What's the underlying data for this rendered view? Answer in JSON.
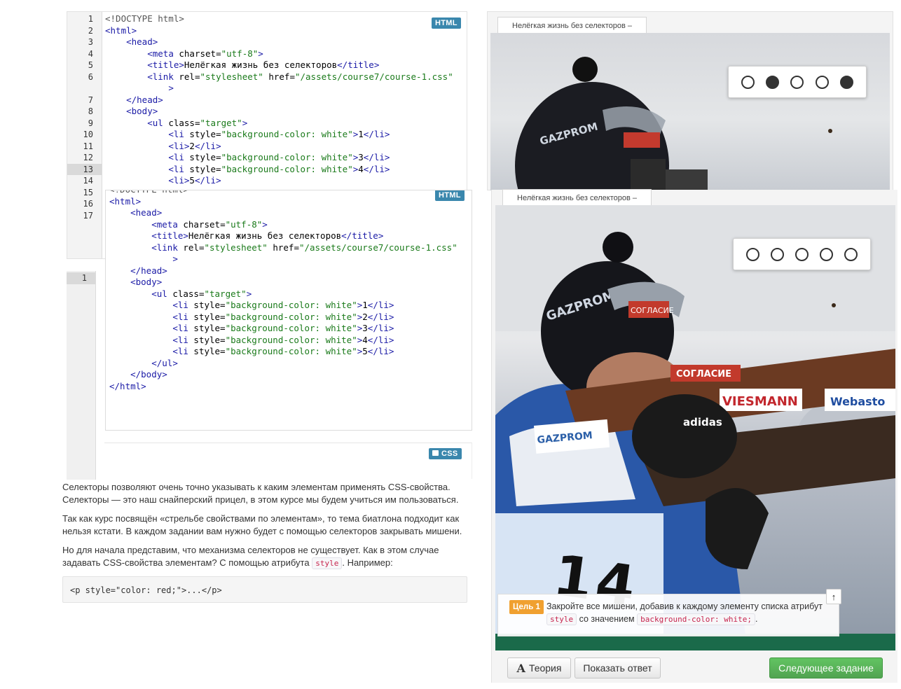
{
  "html_editor_back": {
    "badge": "HTML",
    "line_numbers": [
      "1",
      "2",
      "3",
      "4",
      "5",
      "6",
      "",
      "7",
      "8",
      "9",
      "10",
      "11",
      "12",
      "13",
      "14",
      "15",
      "16",
      "17"
    ],
    "lines": [
      "<!DOCTYPE html>",
      "<html>",
      "    <head>",
      "        <meta charset=\"utf-8\">",
      "        <title>Нелёгкая жизнь без селекторов</title>",
      "        <link rel=\"stylesheet\" href=\"/assets/course7/course-1.css\"",
      "            >",
      "    </head>",
      "    <body>",
      "        <ul class=\"target\">",
      "            <li style=\"background-color: white\">1</li>",
      "            <li>2</li>",
      "            <li style=\"background-color: white\">3</li>",
      "            <li style=\"background-color: white\">4</li>",
      "            <li>5</li>"
    ]
  },
  "html_editor_front": {
    "badge": "HTML",
    "lines": [
      "<!DOCTYPE html>",
      "<html>",
      "    <head>",
      "        <meta charset=\"utf-8\">",
      "        <title>Нелёгкая жизнь без селекторов</title>",
      "        <link rel=\"stylesheet\" href=\"/assets/course7/course-1.css\"",
      "            >",
      "    </head>",
      "    <body>",
      "        <ul class=\"target\">",
      "            <li style=\"background-color: white\">1</li>",
      "            <li style=\"background-color: white\">2</li>",
      "            <li style=\"background-color: white\">3</li>",
      "            <li style=\"background-color: white\">4</li>",
      "            <li style=\"background-color: white\">5</li>",
      "        </ul>",
      "    </body>",
      "</html>"
    ]
  },
  "css_editor": {
    "line_number": "1",
    "badge": "CSS"
  },
  "preview_back": {
    "tab_title": "Нелёгкая жизнь без селекторов –",
    "targets": [
      false,
      true,
      false,
      false,
      true
    ]
  },
  "preview_front": {
    "tab_title": "Нелёгкая жизнь без селекторов –",
    "targets": [
      false,
      false,
      false,
      false,
      false
    ],
    "photo_text": {
      "sponsor1": "GAZPROM",
      "sponsor2": "СОГЛАСИЕ",
      "sponsor3": "VIESMANN",
      "sponsor4": "Webasto",
      "brand": "adidas",
      "bib": "14"
    }
  },
  "theory": {
    "p1": "Селекторы позволяют очень точно указывать к каким элементам применять CSS-свойства. Селекторы — это наш снайперский прицел, в этом курсе мы будем учиться им пользоваться.",
    "p2": "Так как курс посвящён «стрельбе свойствами по элементам», то тема биатлона подходит как нельзя кстати. В каждом задании вам нужно будет с помощью селекторов закрывать мишени.",
    "p3_before": "Но для начала представим, что механизма селекторов не существует. Как в этом случае задавать CSS-свойства элементам? С помощью атрибута ",
    "p3_code": "style",
    "p3_after": ". Например:",
    "example": "<p style=\"color: red;\">...</p>"
  },
  "task": {
    "label": "Цель 1",
    "text_1": "Закройте все мишени, добавив к каждому элементу списка атрибут ",
    "code_1": "style",
    "text_2": " со значением ",
    "code_2": "background-color: white;",
    "text_3": "."
  },
  "buttons": {
    "theory": "Теория",
    "theory_icon": "A",
    "show_answer": "Показать ответ",
    "next_task": "Следующее задание",
    "scroll_top": "↑"
  },
  "colors": {
    "badge": "#3a87ad",
    "task_label": "#f0a030",
    "next_button": "#51a351"
  }
}
